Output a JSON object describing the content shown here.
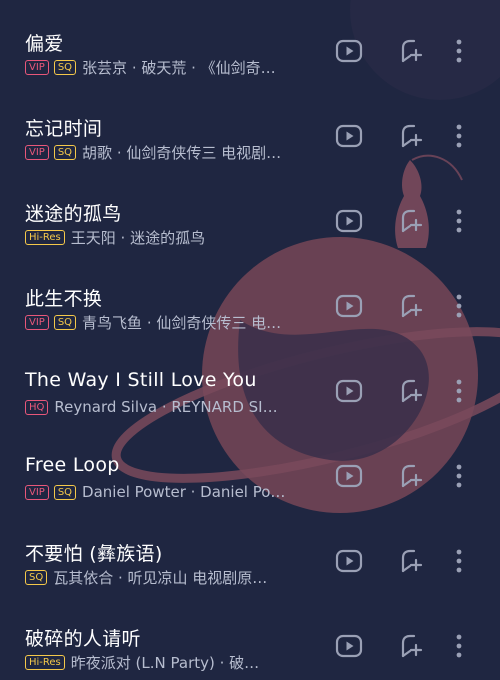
{
  "songs": [
    {
      "title": "偏爱",
      "badges": [
        {
          "text": "VIP",
          "kind": "vip"
        },
        {
          "text": "SQ",
          "kind": "sq"
        }
      ],
      "subtitle": "张芸京 · 破天荒 · 《仙剑奇…"
    },
    {
      "title": "忘记时间",
      "badges": [
        {
          "text": "VIP",
          "kind": "vip"
        },
        {
          "text": "SQ",
          "kind": "sq"
        }
      ],
      "subtitle": "胡歌 · 仙剑奇侠传三 电视剧…"
    },
    {
      "title": "迷途的孤鸟",
      "badges": [
        {
          "text": "Hi-Res",
          "kind": "hires"
        }
      ],
      "subtitle": "王天阳 · 迷途的孤鸟"
    },
    {
      "title": "此生不换",
      "badges": [
        {
          "text": "VIP",
          "kind": "vip"
        },
        {
          "text": "SQ",
          "kind": "sq"
        }
      ],
      "subtitle": "青鸟飞鱼 · 仙剑奇侠传三 电…"
    },
    {
      "title": "The Way I Still Love You",
      "badges": [
        {
          "text": "HQ",
          "kind": "hq"
        }
      ],
      "subtitle": "Reynard Silva · REYNARD SI…"
    },
    {
      "title": "Free Loop",
      "badges": [
        {
          "text": "VIP",
          "kind": "vip"
        },
        {
          "text": "SQ",
          "kind": "sq"
        }
      ],
      "subtitle": "Daniel Powter · Daniel Po…"
    },
    {
      "title": "不要怕 (彝族语)",
      "badges": [
        {
          "text": "SQ",
          "kind": "sq"
        }
      ],
      "subtitle": "瓦其依合 · 听见凉山 电视剧原…"
    },
    {
      "title": "破碎的人请听",
      "badges": [
        {
          "text": "Hi-Res",
          "kind": "hires"
        }
      ],
      "subtitle": "昨夜派对 (L.N Party) · 破…"
    }
  ],
  "icons": {
    "play": "play-video-icon",
    "add": "add-to-playlist-icon",
    "more": "more-vertical-icon"
  },
  "colors": {
    "background": "#1f2641",
    "planet": "#6e4254",
    "vip": "#e8577a",
    "sq": "#f4c84a",
    "icon": "#9aa0b5"
  }
}
